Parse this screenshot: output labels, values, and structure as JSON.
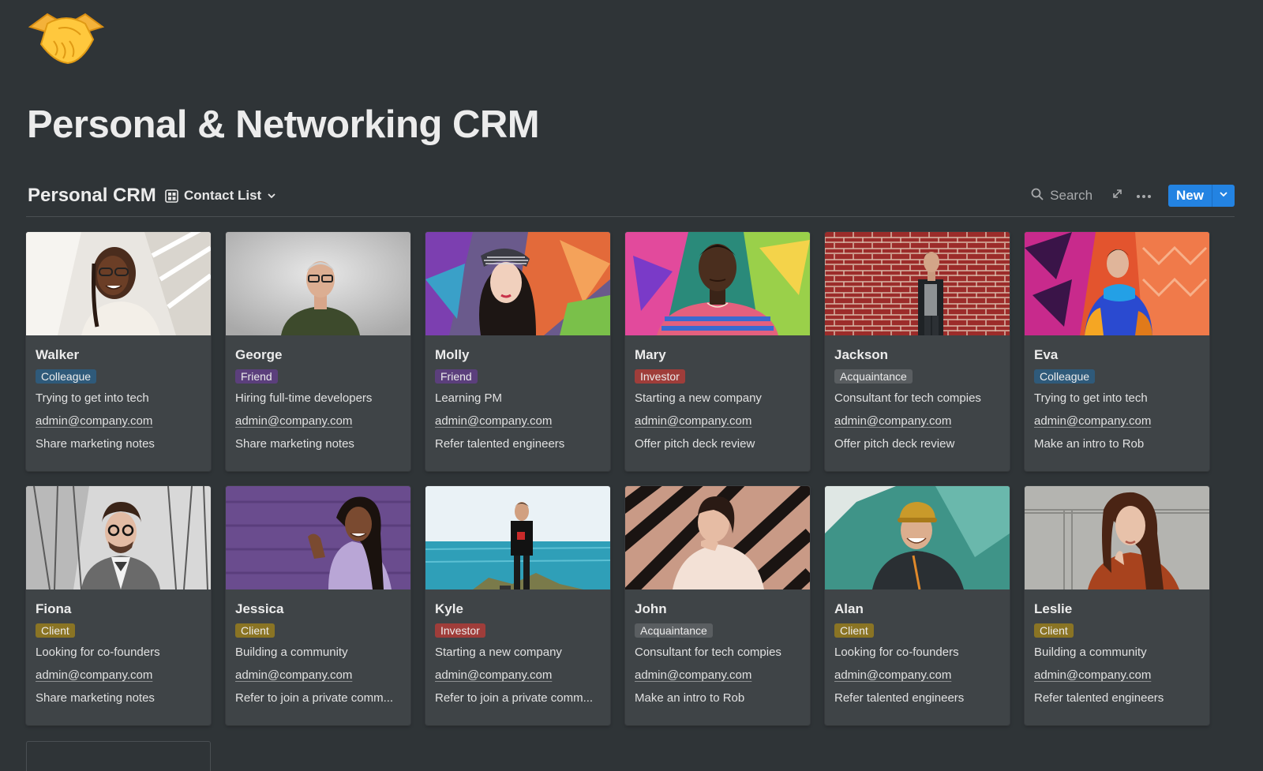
{
  "page": {
    "icon": "handshake-emoji",
    "title": "Personal & Networking CRM"
  },
  "database": {
    "title": "Personal CRM",
    "view": {
      "icon": "gallery-view-icon",
      "label": "Contact List"
    },
    "search_label": "Search",
    "new_label": "New"
  },
  "colors": {
    "background": "#2f3437",
    "card": "#3f4447",
    "accent": "#2383e2",
    "tag_colleague": "#2f5a7a",
    "tag_friend": "#5b3f7c",
    "tag_investor": "#9f3d3a",
    "tag_acquaintance": "#5a5e61",
    "tag_client": "#8a7424"
  },
  "contacts": [
    {
      "name": "Walker",
      "relation": "Colleague",
      "relation_color": "#2f5a7a",
      "note": "Trying to get into tech",
      "email": "admin@company.com",
      "action": "Share marketing notes"
    },
    {
      "name": "George",
      "relation": "Friend",
      "relation_color": "#5b3f7c",
      "note": "Hiring full-time developers",
      "email": "admin@company.com",
      "action": "Share marketing notes"
    },
    {
      "name": "Molly",
      "relation": "Friend",
      "relation_color": "#5b3f7c",
      "note": "Learning PM",
      "email": "admin@company.com",
      "action": "Refer talented engineers"
    },
    {
      "name": "Mary",
      "relation": "Investor",
      "relation_color": "#9f3d3a",
      "note": "Starting a new company",
      "email": "admin@company.com",
      "action": "Offer pitch deck review"
    },
    {
      "name": "Jackson",
      "relation": "Acquaintance",
      "relation_color": "#5a5e61",
      "note": "Consultant for tech compies",
      "email": "admin@company.com",
      "action": "Offer pitch deck review"
    },
    {
      "name": "Eva",
      "relation": "Colleague",
      "relation_color": "#2f5a7a",
      "note": "Trying to get into tech",
      "email": "admin@company.com",
      "action": "Make an intro to Rob"
    },
    {
      "name": "Fiona",
      "relation": "Client",
      "relation_color": "#8a7424",
      "note": "Looking for co-founders",
      "email": "admin@company.com",
      "action": "Share marketing notes"
    },
    {
      "name": "Jessica",
      "relation": "Client",
      "relation_color": "#8a7424",
      "note": "Building a community",
      "email": "admin@company.com",
      "action": "Refer to join a private comm..."
    },
    {
      "name": "Kyle",
      "relation": "Investor",
      "relation_color": "#9f3d3a",
      "note": "Starting a new company",
      "email": "admin@company.com",
      "action": "Refer to join a private comm..."
    },
    {
      "name": "John",
      "relation": "Acquaintance",
      "relation_color": "#5a5e61",
      "note": "Consultant for tech compies",
      "email": "admin@company.com",
      "action": "Make an intro to Rob"
    },
    {
      "name": "Alan",
      "relation": "Client",
      "relation_color": "#8a7424",
      "note": "Looking for co-founders",
      "email": "admin@company.com",
      "action": "Refer talented engineers"
    },
    {
      "name": "Leslie",
      "relation": "Client",
      "relation_color": "#8a7424",
      "note": "Building a community",
      "email": "admin@company.com",
      "action": "Refer talented engineers"
    }
  ]
}
